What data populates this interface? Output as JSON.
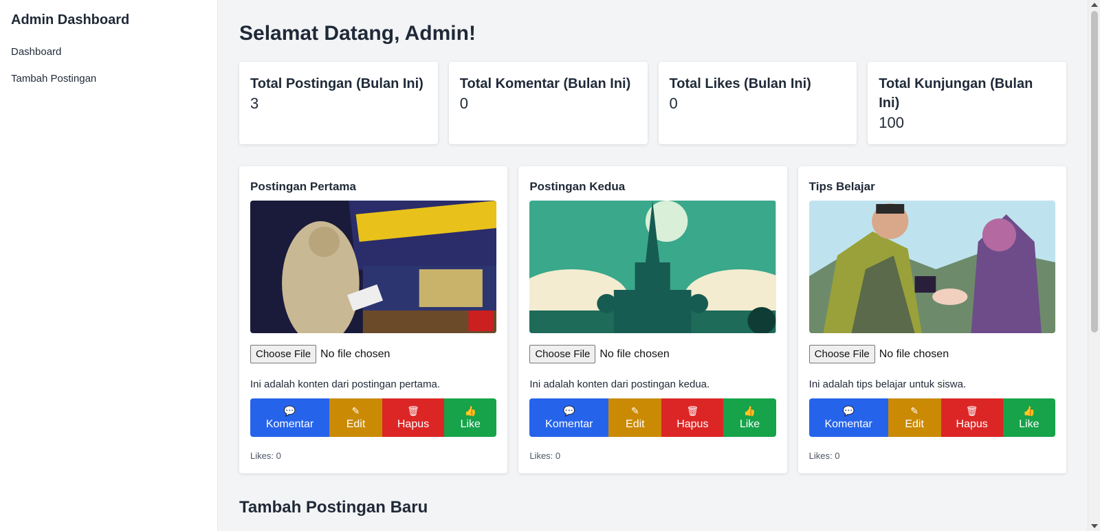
{
  "sidebar": {
    "title": "Admin Dashboard",
    "items": [
      {
        "label": "Dashboard"
      },
      {
        "label": "Tambah Postingan"
      }
    ]
  },
  "main": {
    "welcome": "Selamat Datang, Admin!",
    "stats": [
      {
        "label": "Total Postingan (Bulan Ini)",
        "value": "3"
      },
      {
        "label": "Total Komentar (Bulan Ini)",
        "value": "0"
      },
      {
        "label": "Total Likes (Bulan Ini)",
        "value": "0"
      },
      {
        "label": "Total Kunjungan (Bulan Ini)",
        "value": "100"
      }
    ],
    "posts": [
      {
        "title": "Postingan Pertama",
        "file_button": "Choose File",
        "file_status": "No file chosen",
        "content": "Ini adalah konten dari postingan pertama.",
        "likes": "Likes: 0"
      },
      {
        "title": "Postingan Kedua",
        "file_button": "Choose File",
        "file_status": "No file chosen",
        "content": "Ini adalah konten dari postingan kedua.",
        "likes": "Likes: 0"
      },
      {
        "title": "Tips Belajar",
        "file_button": "Choose File",
        "file_status": "No file chosen",
        "content": "Ini adalah tips belajar untuk siswa.",
        "likes": "Likes: 0"
      }
    ],
    "actions": {
      "comment": "Komentar",
      "edit": "Edit",
      "delete": "Hapus",
      "like": "Like"
    },
    "add_title": "Tambah Postingan Baru"
  },
  "colors": {
    "comment": "#2563eb",
    "edit": "#ca8a04",
    "delete": "#dc2626",
    "like": "#16a34a"
  }
}
